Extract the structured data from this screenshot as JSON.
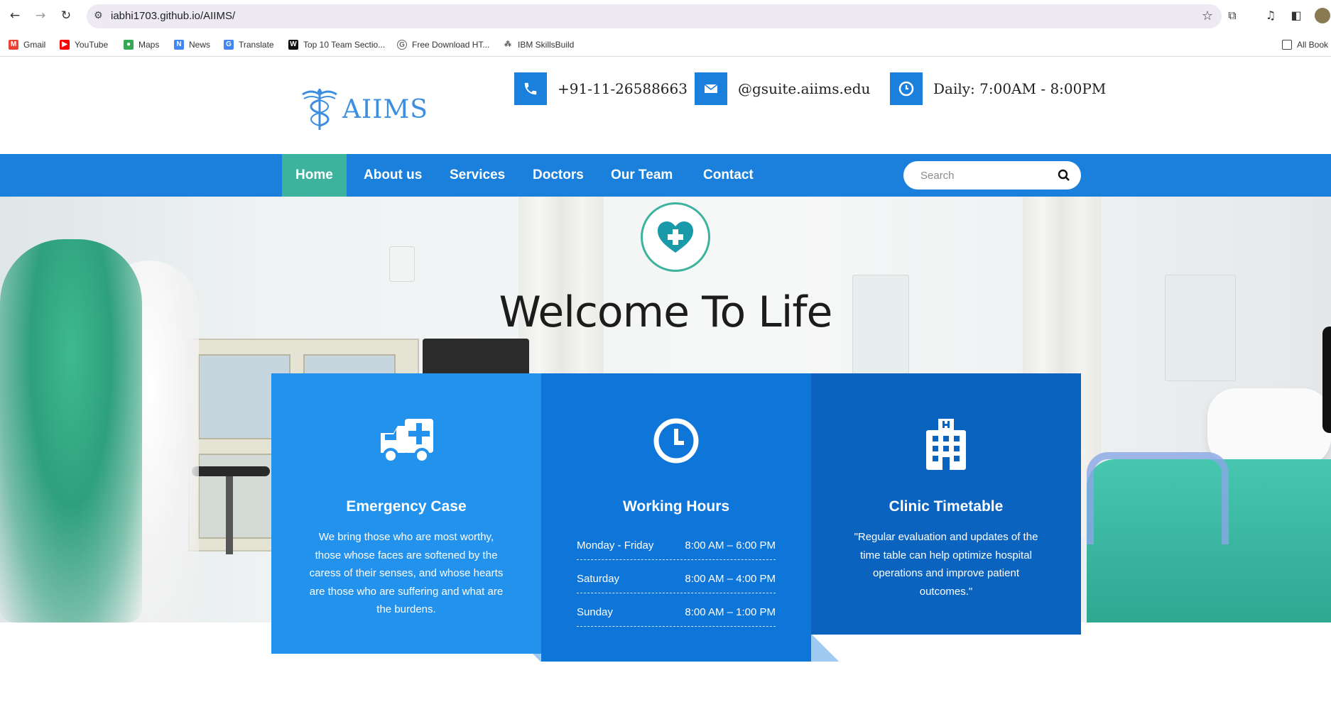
{
  "browser": {
    "url": "iabhi1703.github.io/AIIMS/",
    "bookmarks": [
      {
        "label": "Gmail",
        "color": "#ea4335"
      },
      {
        "label": "YouTube",
        "color": "#ff0000"
      },
      {
        "label": "Maps",
        "color": "#34a853"
      },
      {
        "label": "News",
        "color": "#4285f4"
      },
      {
        "label": "Translate",
        "color": "#4285f4"
      },
      {
        "label": "Top 10 Team Sectio...",
        "color": "#111111"
      },
      {
        "label": "Free Download HT...",
        "color": "#666666"
      },
      {
        "label": "IBM SkillsBuild",
        "color": "#555555"
      }
    ],
    "all_bookmarks": "All Book"
  },
  "header": {
    "logo_text": "AIIMS",
    "phone": "+91-11-26588663",
    "email": "@gsuite.aiims.edu",
    "hours": "Daily: 7:00AM - 8:00PM",
    "accent": "#1a80db"
  },
  "nav": {
    "items": [
      "Home",
      "About us",
      "Services",
      "Doctors",
      "Our Team",
      "Contact"
    ],
    "active": "Home",
    "active_color": "#3db39e",
    "search_placeholder": "Search"
  },
  "hero": {
    "title": "Welcome To Life"
  },
  "features": {
    "emergency": {
      "title": "Emergency Case",
      "text": "We bring those who are most worthy, those whose faces are softened by the caress of their senses, and whose hearts are those who are suffering and what are the burdens."
    },
    "working_hours": {
      "title": "Working Hours",
      "rows": [
        {
          "day": "Monday - Friday",
          "time": "8:00 AM – 6:00 PM"
        },
        {
          "day": "Saturday",
          "time": "8:00 AM – 4:00 PM"
        },
        {
          "day": "Sunday",
          "time": "8:00 AM – 1:00 PM"
        }
      ]
    },
    "timetable": {
      "title": "Clinic Timetable",
      "text": "\"Regular evaluation and updates of the time table can help optimize hospital operations and improve patient outcomes.\""
    }
  }
}
